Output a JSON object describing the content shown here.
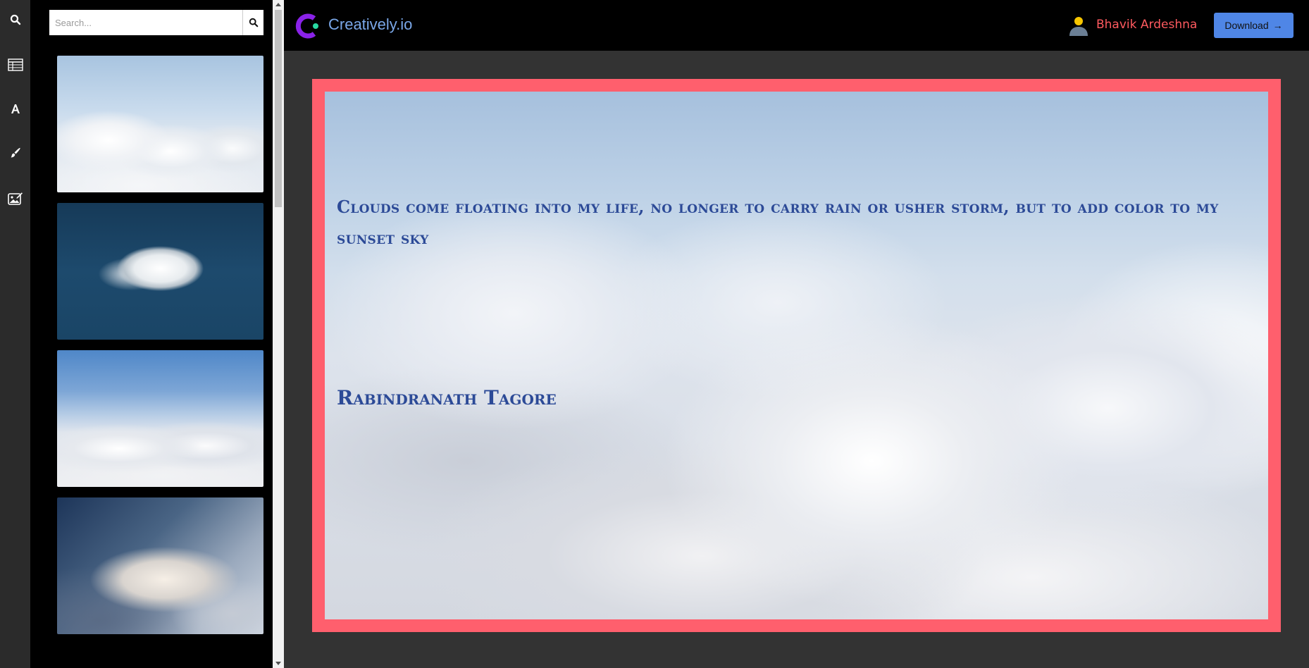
{
  "app": {
    "brand": "Creatively.io",
    "colors": {
      "accent": "#4f86e6",
      "frame": "#ff5f6d",
      "user_name": "#ff5a5f",
      "brand_text": "#7aa7e8",
      "quote_text": "#2c4a97"
    }
  },
  "rail": {
    "items": [
      {
        "icon": "search-icon"
      },
      {
        "icon": "table-icon"
      },
      {
        "icon": "text-icon"
      },
      {
        "icon": "brush-icon"
      },
      {
        "icon": "image-edit-icon"
      }
    ]
  },
  "panel": {
    "search": {
      "placeholder": "Search...",
      "value": ""
    },
    "thumbnails": [
      {
        "subject": "clouds above horizon"
      },
      {
        "subject": "single cloud on blue sky"
      },
      {
        "subject": "cloud layer under blue sky"
      },
      {
        "subject": "storm cloud tower"
      }
    ]
  },
  "header": {
    "user_name": "Bhavik Ardeshna",
    "download_label": "Download",
    "download_arrow": "→"
  },
  "canvas": {
    "quote": "Clouds come floating into my life, no longer to carry rain or usher storm, but to add color to my sunset sky",
    "author": "Rabindranath Tagore"
  }
}
